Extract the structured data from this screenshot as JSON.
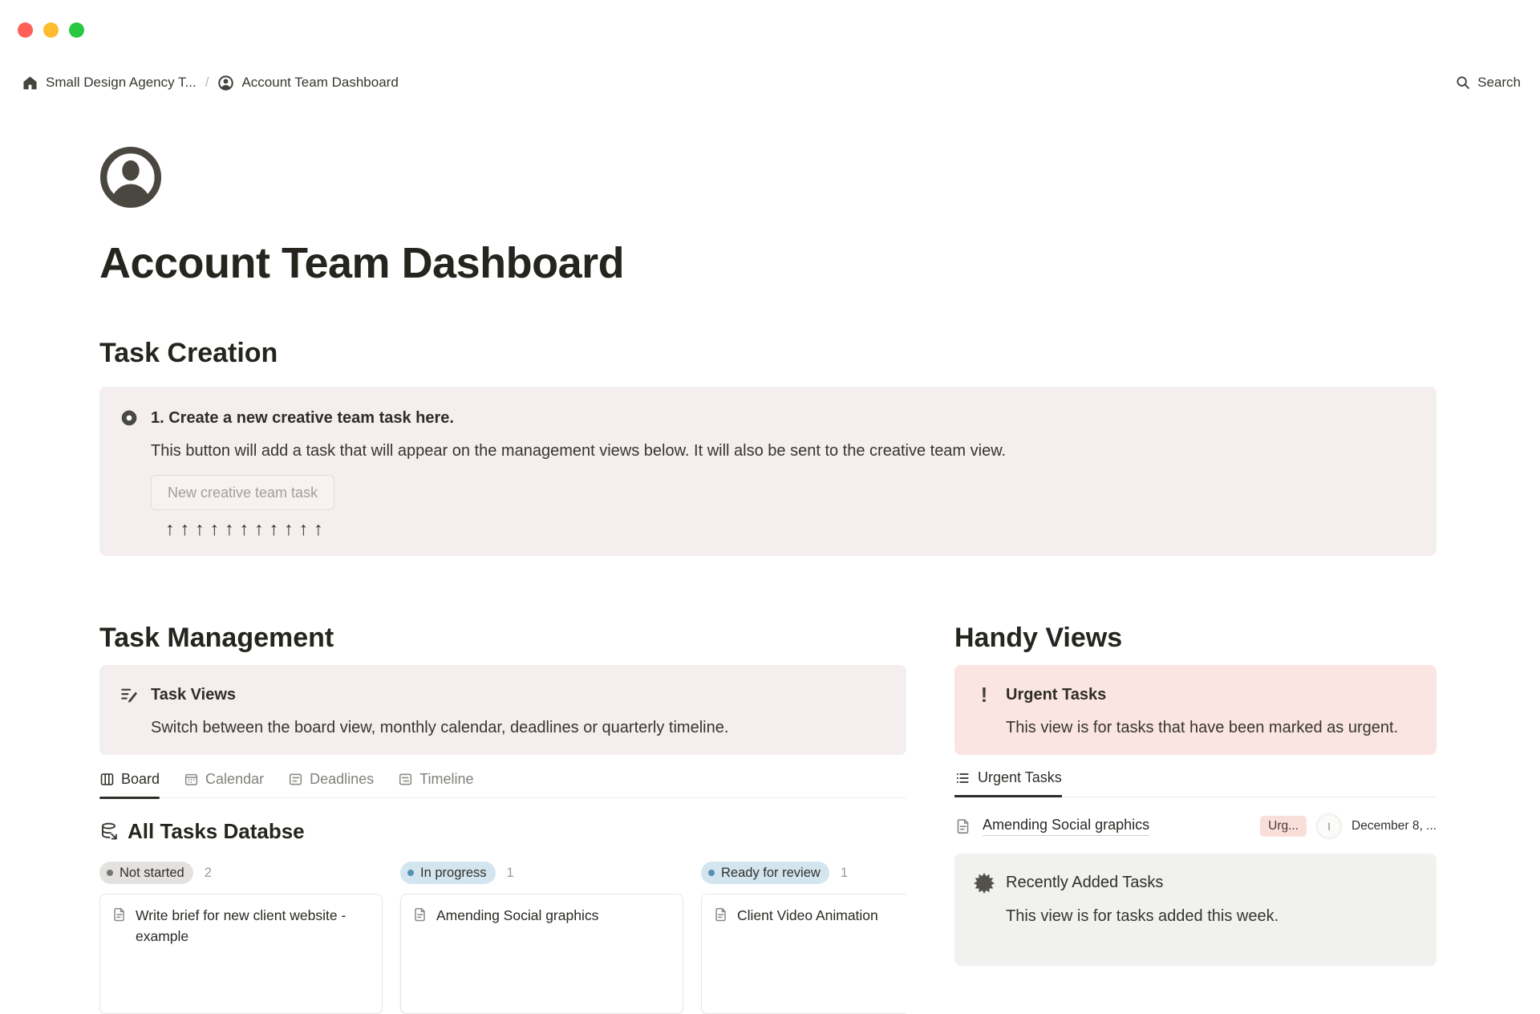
{
  "window": {
    "controls": [
      "close",
      "minimize",
      "zoom"
    ]
  },
  "breadcrumb": {
    "workspace": "Small Design Agency T...",
    "separator": "/",
    "page": "Account Team Dashboard",
    "search_label": "Search"
  },
  "page": {
    "title": "Account Team Dashboard"
  },
  "task_creation": {
    "heading": "Task Creation",
    "callout": {
      "title": "1. Create a new creative team task here.",
      "description": "This button will add a task that will appear on the management views below. It will also be sent to the creative team view.",
      "button_label": "New creative team task",
      "arrows": "↑↑↑↑↑↑↑↑↑↑↑"
    }
  },
  "task_management": {
    "heading": "Task Management",
    "callout": {
      "title": "Task Views",
      "description": "Switch between the board view, monthly calendar, deadlines or quarterly timeline."
    },
    "tabs": [
      {
        "label": "Board",
        "active": true
      },
      {
        "label": "Calendar",
        "active": false
      },
      {
        "label": "Deadlines",
        "active": false
      },
      {
        "label": "Timeline",
        "active": false
      }
    ],
    "database_title": "All Tasks Databse",
    "board": {
      "columns": [
        {
          "status": "Not started",
          "count": "2",
          "color": "gray",
          "cards": [
            {
              "title": "Write brief for new client website - example"
            }
          ]
        },
        {
          "status": "In progress",
          "count": "1",
          "color": "blue",
          "cards": [
            {
              "title": "Amending Social graphics"
            }
          ]
        },
        {
          "status": "Ready for review",
          "count": "1",
          "color": "blue",
          "cards": [
            {
              "title": "Client Video Animation"
            }
          ]
        }
      ]
    }
  },
  "handy_views": {
    "heading": "Handy Views",
    "urgent_callout": {
      "title": "Urgent Tasks",
      "description": "This view is for tasks that have been marked as urgent."
    },
    "tab_label": "Urgent Tasks",
    "row": {
      "title": "Amending Social graphics",
      "tag": "Urg...",
      "avatar_initial": "I",
      "date": "December 8, ..."
    },
    "recent_callout": {
      "title": "Recently Added Tasks",
      "description": "This view is for tasks added this week."
    }
  },
  "icons": {
    "home-icon": "filled house glyph",
    "person-circle-icon": "person inside circle",
    "search-icon": "magnifier",
    "button-block-icon": "dark donut circle",
    "compose-icon": "lines with pencil",
    "board-icon": "three columns",
    "calendar-icon": "calendar grid",
    "list-page-icon": "card with lines",
    "database-icon": "stacked disks with arrow",
    "document-icon": "page with folded corner",
    "exclamation-icon": "!",
    "list-view-icon": "bulleted list",
    "seal-icon": "twelve point badge"
  },
  "colors": {
    "callout_brown_bg": "#f4eeee",
    "callout_pink_bg": "#fbe5e3",
    "callout_gray_bg": "#f1f1ef",
    "status_gray_bg": "#e3e2e0",
    "status_blue_bg": "#d3e5ef",
    "status_blue_dot": "#5690b4",
    "urgent_tag_bg": "#fadeda",
    "traffic_red": "#ff5f57",
    "traffic_yellow": "#febc2e",
    "traffic_green": "#28c840",
    "text_primary": "#37352f"
  }
}
